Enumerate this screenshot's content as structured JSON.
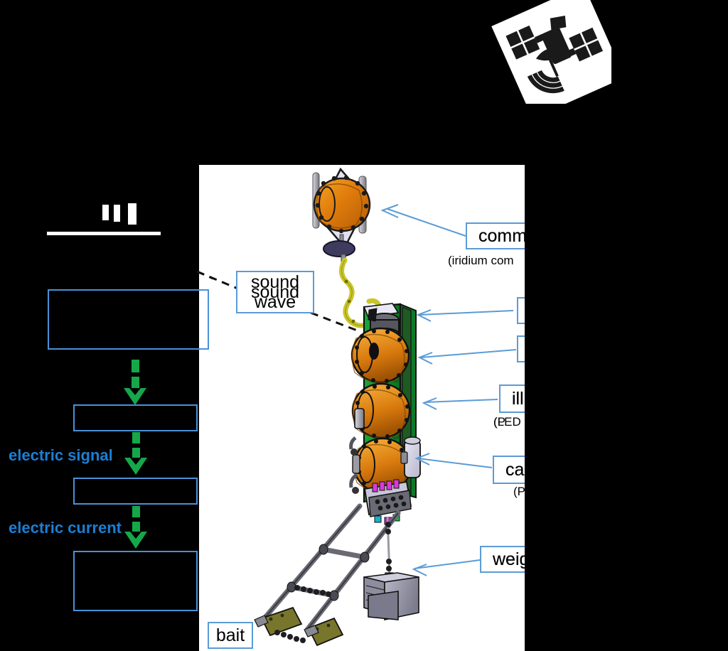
{
  "figure": {
    "title_redacted": true,
    "background": "#000000",
    "plate_color": "#ffffff",
    "accent_blue": "#5B9BD5",
    "flow_blue": "#1B7FD4",
    "arrow_green": "#16A74A"
  },
  "icons": {
    "satellite": "satellite-icon"
  },
  "callouts": [
    {
      "id": "communication",
      "label": "comm",
      "sub": "(iridium com",
      "masked": true
    },
    {
      "id": "unknown-1",
      "label": "",
      "sub": "",
      "masked": true
    },
    {
      "id": "unknown-2",
      "label": "",
      "sub": "",
      "masked": true
    },
    {
      "id": "illumination",
      "label": "illu",
      "sub": "(LED",
      "masked": true
    },
    {
      "id": "camera",
      "label": "cam",
      "sub": "(P",
      "masked": true
    },
    {
      "id": "weight",
      "label": "weigh",
      "sub": "",
      "masked": true
    }
  ],
  "plate_labels": {
    "sound_wave": "sound\nwave",
    "sound_wave_line1": "sound",
    "sound_wave_line2": "wave",
    "bait": "bait"
  },
  "flow": {
    "boxes": [
      {
        "id": "flow-box-1",
        "text": ""
      },
      {
        "id": "flow-box-2",
        "text": ""
      },
      {
        "id": "flow-box-3",
        "text": ""
      },
      {
        "id": "flow-box-4",
        "text": ""
      }
    ],
    "arrow_labels": [
      {
        "id": "electric-signal",
        "text": "electric signal"
      },
      {
        "id": "electric-current",
        "text": "electric current"
      }
    ]
  }
}
